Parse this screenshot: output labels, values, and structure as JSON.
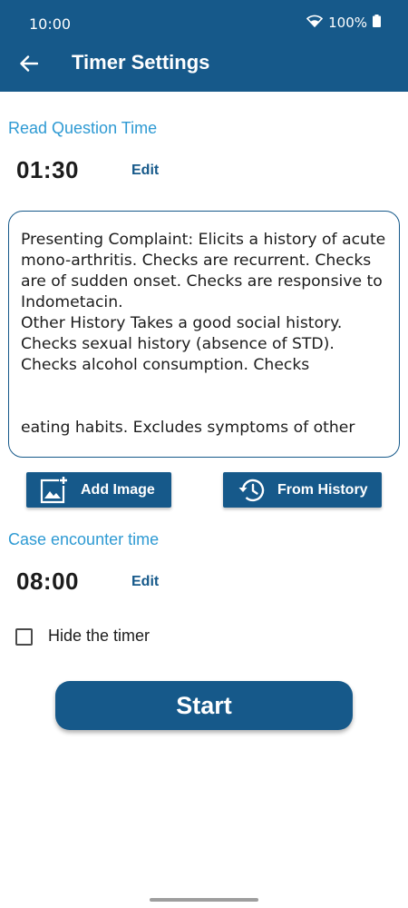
{
  "status_bar": {
    "time": "10:00",
    "battery": "100%"
  },
  "header": {
    "title": "Timer Settings",
    "background": "#16598a"
  },
  "read_question": {
    "label": "Read Question Time",
    "time": "01:30",
    "edit_label": "Edit"
  },
  "question_text": {
    "paragraph_1": "Presenting Complaint: Elicits a history of acute mono-arthritis. Checks are recurrent. Checks are of sudden onset. Checks are responsive to Indometacin.",
    "paragraph_2": "Other History Takes a good social history. Checks sexual history (absence of STD). Checks alcohol consumption. Checks",
    "paragraph_3": "eating habits. Excludes symptoms of other"
  },
  "buttons": {
    "add_image": "Add Image",
    "from_history": "From History",
    "start": "Start"
  },
  "case_encounter": {
    "label": "Case encounter time",
    "time": "08:00",
    "edit_label": "Edit"
  },
  "hide_timer": {
    "label": "Hide the timer",
    "checked": false
  },
  "colors": {
    "primary": "#16598a",
    "label_blue": "#2e9ad3"
  }
}
